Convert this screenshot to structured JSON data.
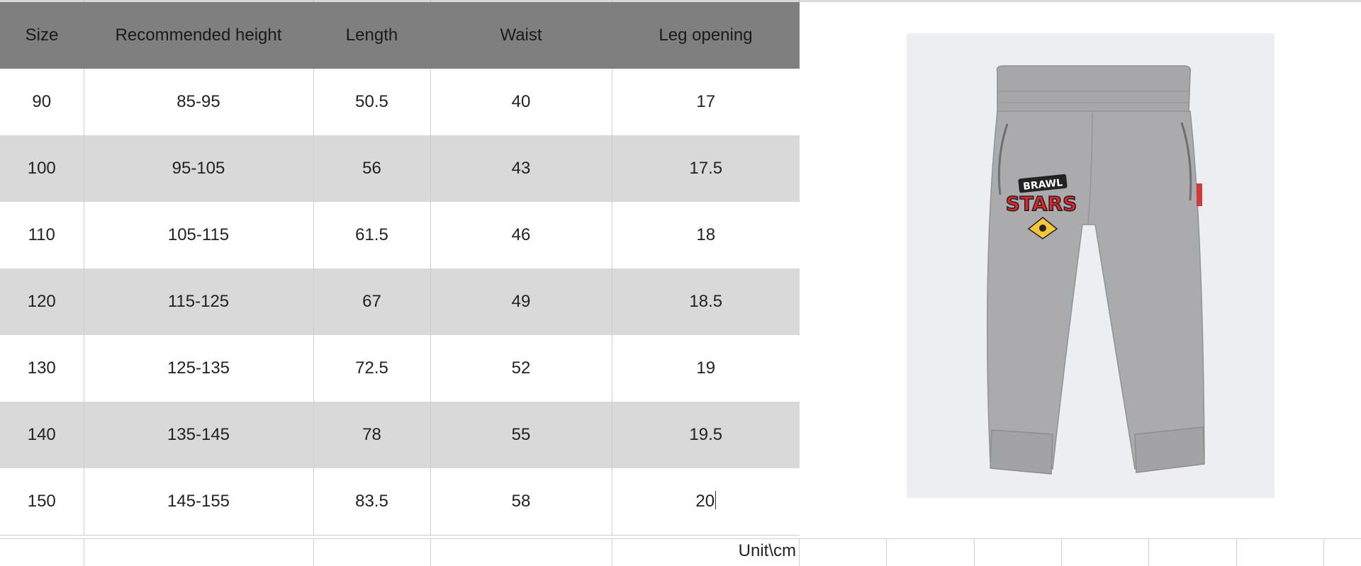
{
  "table": {
    "headers": [
      "Size",
      "Recommended height",
      "Length",
      "Waist",
      "Leg opening"
    ],
    "rows": [
      [
        "90",
        "85-95",
        "50.5",
        "40",
        "17"
      ],
      [
        "100",
        "95-105",
        "56",
        "43",
        "17.5"
      ],
      [
        "110",
        "105-115",
        "61.5",
        "46",
        "18"
      ],
      [
        "120",
        "115-125",
        "67",
        "49",
        "18.5"
      ],
      [
        "130",
        "125-135",
        "72.5",
        "52",
        "19"
      ],
      [
        "140",
        "135-145",
        "78",
        "55",
        "19.5"
      ],
      [
        "150",
        "145-155",
        "83.5",
        "58",
        "20"
      ]
    ]
  },
  "unit_note": "Unit\\cm",
  "product_image": {
    "logo_text_top": "BRAWL",
    "logo_text_bottom": "STARS",
    "garment_color": "#a9a9ab"
  },
  "colors": {
    "header_bg": "#7f7f7f",
    "alt_row_bg": "#d9d9d9",
    "photo_bg": "#eceef1",
    "logo_red": "#e4252b"
  }
}
